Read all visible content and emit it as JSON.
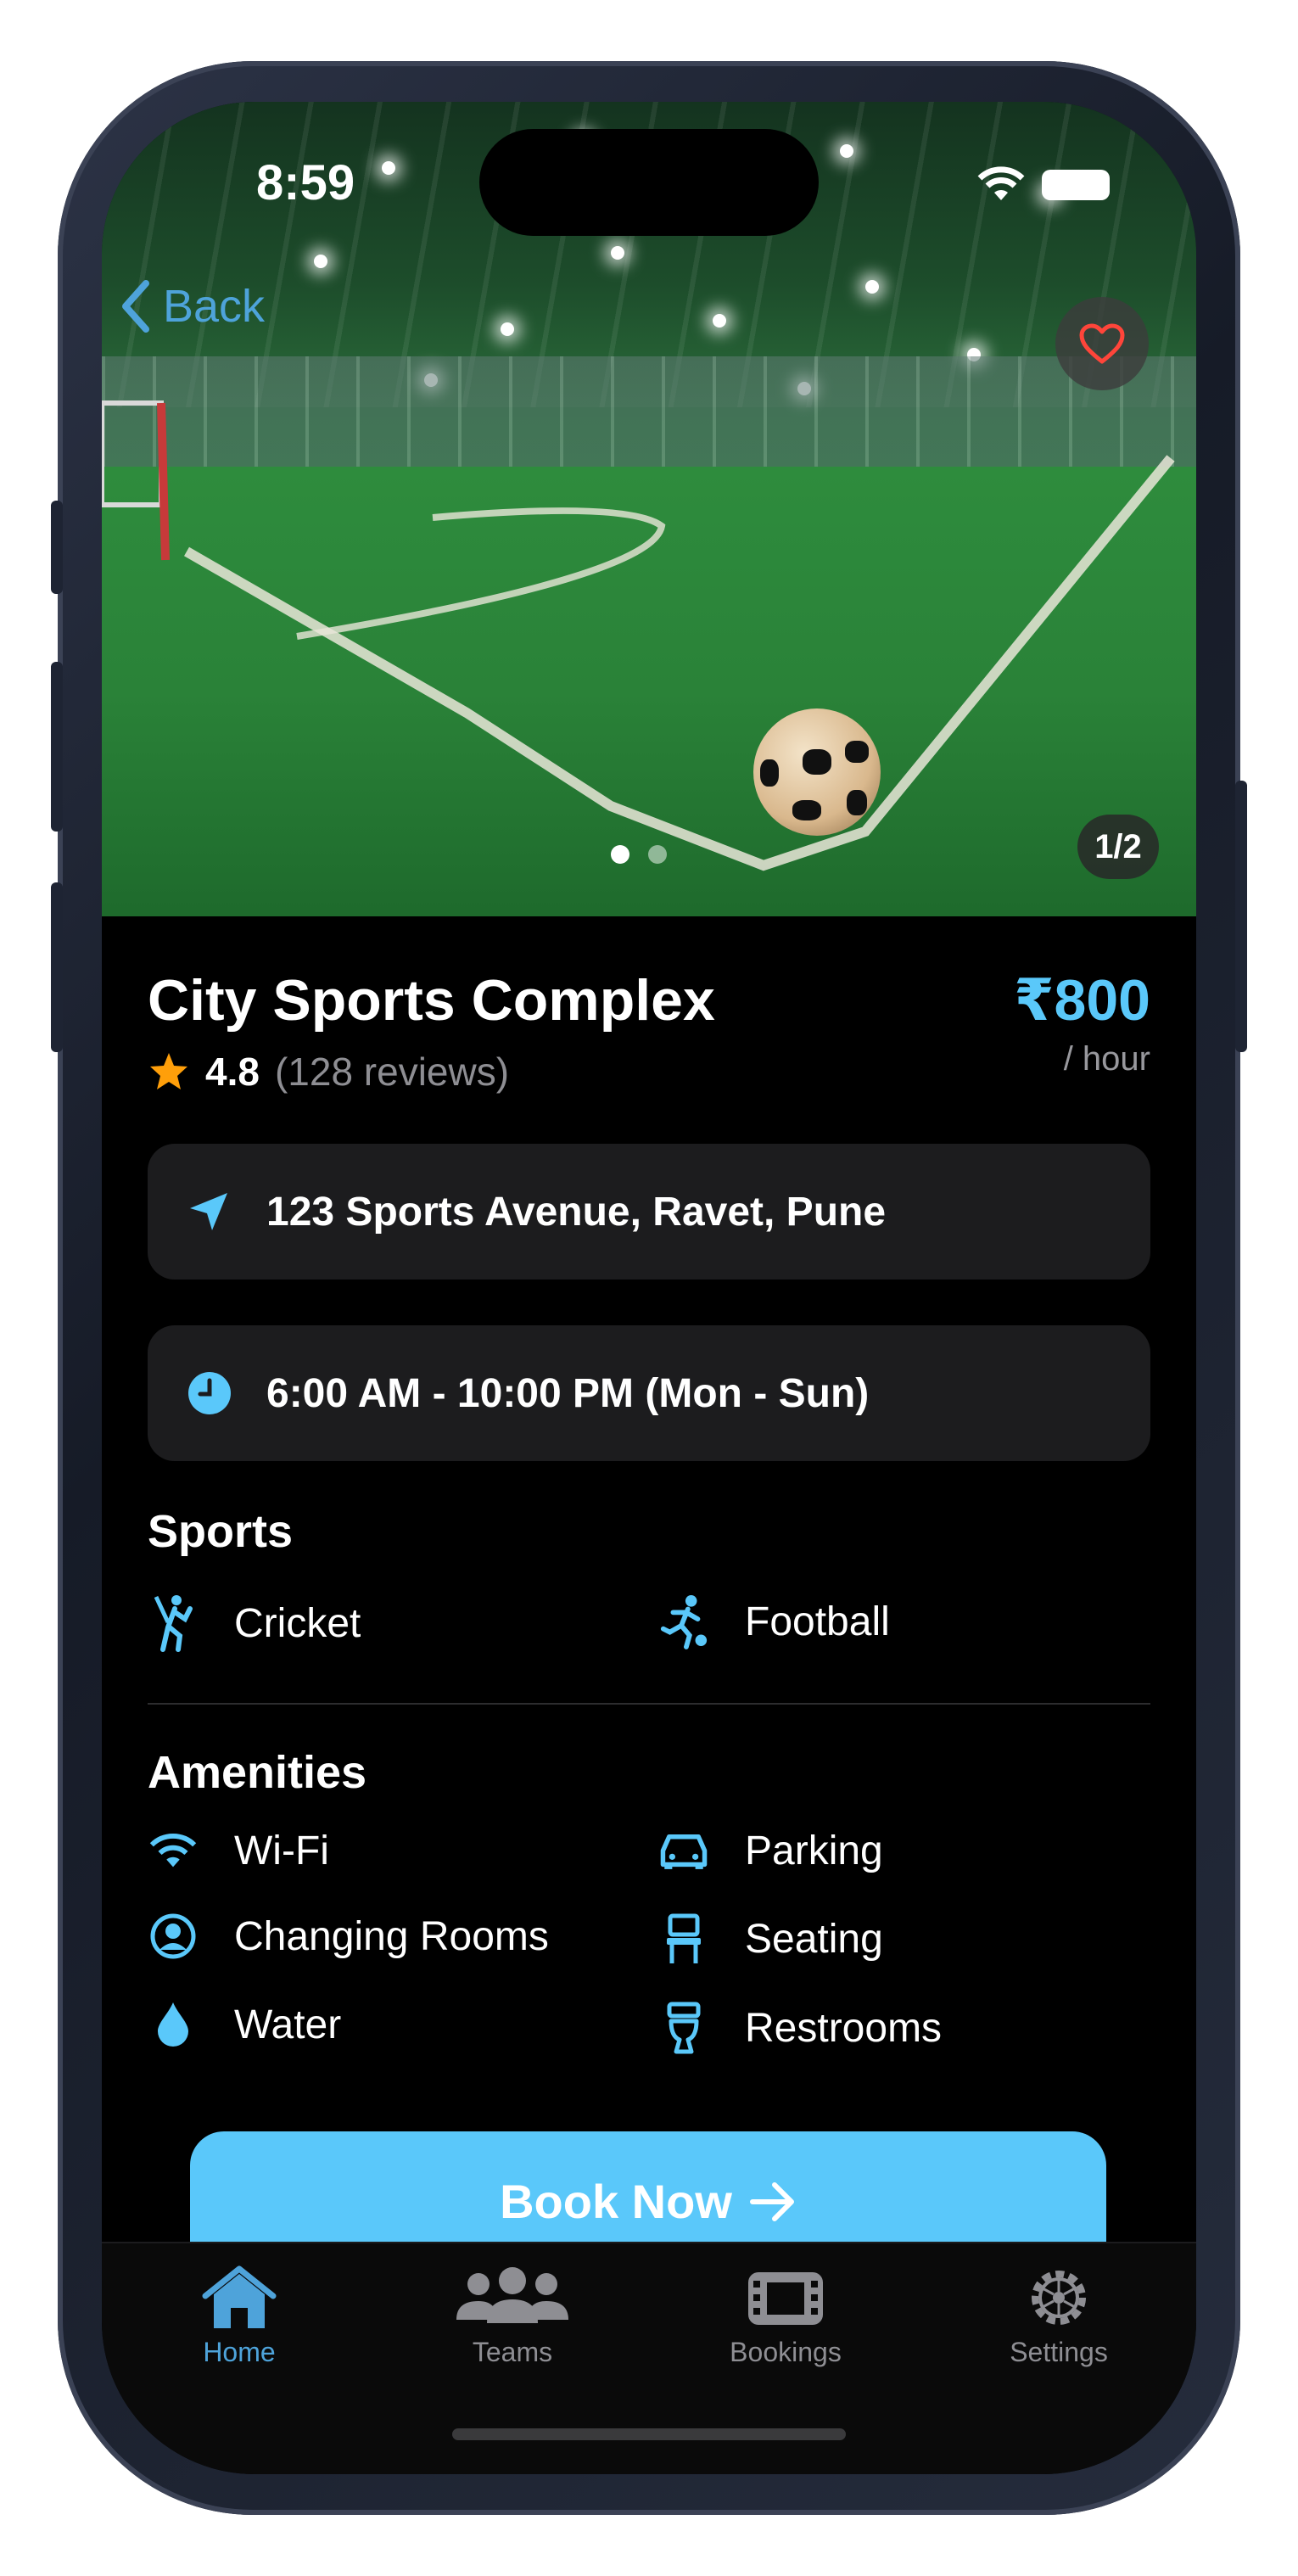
{
  "status": {
    "time": "8:59"
  },
  "nav": {
    "back_label": "Back"
  },
  "hero": {
    "page_counter": "1/2",
    "dots": 2,
    "active_dot": 1
  },
  "venue": {
    "name": "City Sports Complex",
    "rating": "4.8",
    "reviews": "(128 reviews)",
    "price": "₹800",
    "price_unit": "/ hour",
    "address": "123 Sports Avenue, Ravet, Pune",
    "hours": "6:00 AM - 10:00 PM (Mon - Sun)"
  },
  "sports": {
    "heading": "Sports",
    "items": [
      {
        "label": "Cricket",
        "icon": "cricket-icon"
      },
      {
        "label": "Football",
        "icon": "football-player-icon"
      }
    ]
  },
  "amenities": {
    "heading": "Amenities",
    "items": [
      {
        "label": "Wi-Fi",
        "icon": "wifi-icon"
      },
      {
        "label": "Parking",
        "icon": "car-icon"
      },
      {
        "label": "Changing Rooms",
        "icon": "person-circle-icon"
      },
      {
        "label": "Seating",
        "icon": "chair-icon"
      },
      {
        "label": "Water",
        "icon": "drop-icon"
      },
      {
        "label": "Restrooms",
        "icon": "toilet-icon"
      }
    ]
  },
  "cta": {
    "label": "Book Now"
  },
  "tabs": [
    {
      "label": "Home",
      "icon": "house-icon",
      "active": true
    },
    {
      "label": "Teams",
      "icon": "people-icon",
      "active": false
    },
    {
      "label": "Bookings",
      "icon": "film-icon",
      "active": false
    },
    {
      "label": "Settings",
      "icon": "gear-icon",
      "active": false
    }
  ],
  "colors": {
    "accent": "#5ac8fa",
    "background": "#000000",
    "card": "#1c1c1e",
    "heart": "#ff453a",
    "star": "#ff9f0a"
  }
}
